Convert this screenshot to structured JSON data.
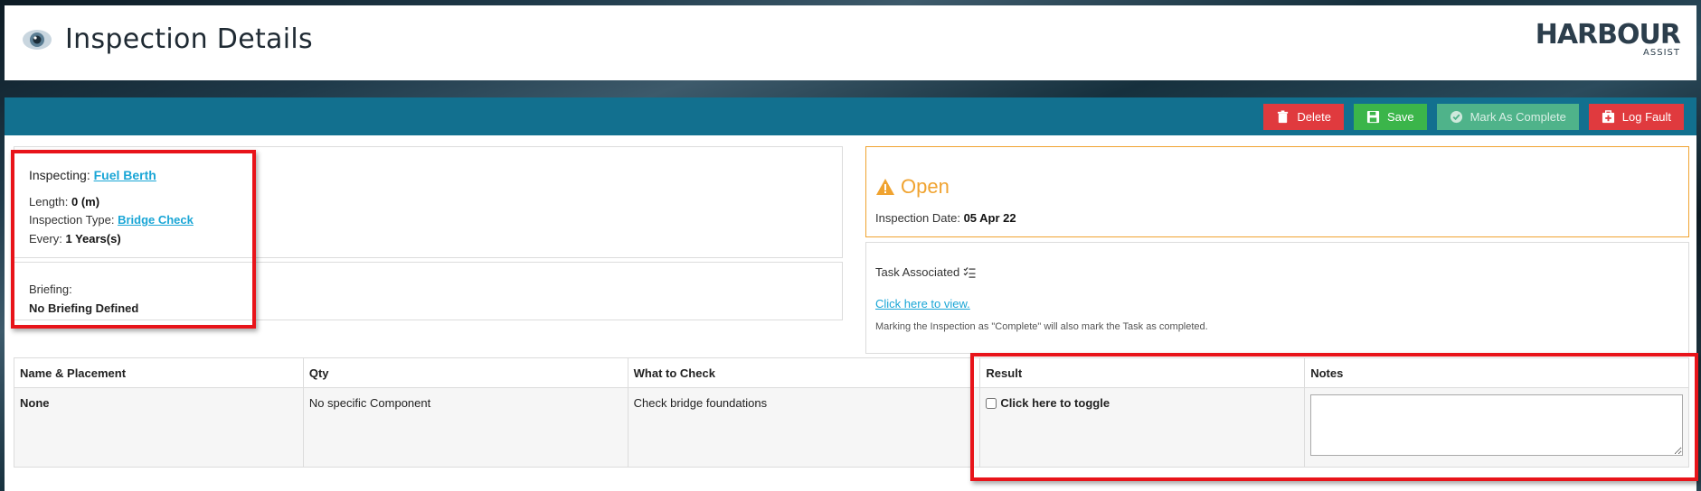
{
  "header": {
    "title": "Inspection Details",
    "logo": {
      "main": "HARBOUR",
      "sub": "ASSIST"
    }
  },
  "toolbar": {
    "delete_label": "Delete",
    "save_label": "Save",
    "complete_label": "Mark As Complete",
    "fault_label": "Log Fault"
  },
  "inspecting": {
    "label": "Inspecting:",
    "target": "Fuel Berth",
    "length_label": "Length:",
    "length_value": "0 (m)",
    "type_label": "Inspection Type:",
    "type_value": "Bridge Check",
    "every_label": "Every:",
    "every_value": "1 Years(s)"
  },
  "briefing": {
    "label": "Briefing:",
    "value": "No Briefing Defined"
  },
  "status": {
    "text": "Open",
    "color": "#f0a330",
    "date_label": "Inspection Date:",
    "date_value": "05 Apr 22"
  },
  "task": {
    "label": "Task Associated",
    "link": "Click here to view.",
    "note": "Marking the Inspection as \"Complete\" will also mark the Task as completed."
  },
  "table": {
    "headers": [
      "Name & Placement",
      "Qty",
      "What to Check",
      "Result",
      "Notes"
    ],
    "rows": [
      {
        "name": "None",
        "qty": "No specific Component",
        "check": "Check bridge foundations",
        "result_toggle": "Click here to toggle",
        "result_checked": false,
        "notes": ""
      }
    ]
  },
  "colors": {
    "header_bar": "#12708f",
    "delete": "#e03a3e",
    "save": "#3bb54a",
    "complete": "#4fb38a",
    "fault": "#e03a3e",
    "link": "#1aa6d6",
    "highlight": "#e8141a"
  }
}
